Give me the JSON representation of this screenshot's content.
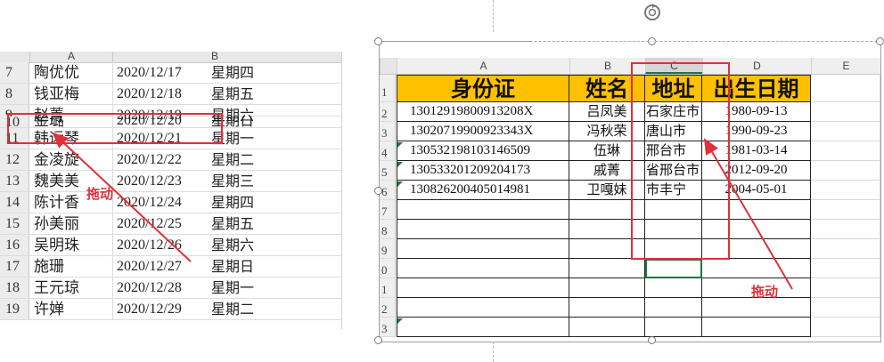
{
  "left_sheet": {
    "columns": [
      "A",
      "B"
    ],
    "rows": [
      {
        "num": "7",
        "name": "陶优优",
        "date": "2020/12/17",
        "week": "星期四"
      },
      {
        "num": "8",
        "name": "钱亚梅",
        "date": "2020/12/18",
        "week": "星期五"
      },
      {
        "num": "9",
        "name": "赵菁",
        "date": "2020/12/19",
        "week": "星期六"
      },
      {
        "num": "10",
        "name": "金璐",
        "date": "2020/12/20",
        "week": "星期日"
      },
      {
        "num": "11",
        "name": "韩远琴",
        "date": "2020/12/21",
        "week": "星期一"
      },
      {
        "num": "12",
        "name": "金凌旋",
        "date": "2020/12/22",
        "week": "星期二"
      },
      {
        "num": "13",
        "name": "魏美美",
        "date": "2020/12/23",
        "week": "星期三"
      },
      {
        "num": "14",
        "name": "陈计香",
        "date": "2020/12/24",
        "week": "星期四"
      },
      {
        "num": "15",
        "name": "孙美丽",
        "date": "2020/12/25",
        "week": "星期五"
      },
      {
        "num": "16",
        "name": "吴明珠",
        "date": "2020/12/26",
        "week": "星期六"
      },
      {
        "num": "17",
        "name": "施珊",
        "date": "2020/12/27",
        "week": "星期日"
      },
      {
        "num": "18",
        "name": "王元琼",
        "date": "2020/12/28",
        "week": "星期一"
      },
      {
        "num": "19",
        "name": "许婵",
        "date": "2020/12/29",
        "week": "星期二"
      }
    ],
    "annotation": "拖动"
  },
  "right_sheet": {
    "columns": [
      "A",
      "B",
      "C",
      "D",
      "E"
    ],
    "selected_column": "C",
    "header_row": {
      "num": "1",
      "cells": [
        "身份证",
        "姓名",
        "地址",
        "出生日期"
      ]
    },
    "data_rows": [
      {
        "num": "2",
        "id": "13012919800913208X",
        "name": "吕凤美",
        "addr": "石家庄市",
        "birth": "1980-09-13",
        "flag": false
      },
      {
        "num": "3",
        "id": "13020719900923343X",
        "name": "冯秋荣",
        "addr": "唐山市",
        "birth": "1990-09-23",
        "flag": false
      },
      {
        "num": "4",
        "id": "130532198103146509",
        "name": "伍琳",
        "addr": "邢台市",
        "birth": "1981-03-14",
        "flag": true
      },
      {
        "num": "5",
        "id": "130533201209204173",
        "name": "戚菁",
        "addr": "省邢台市",
        "birth": "2012-09-20",
        "flag": true
      },
      {
        "num": "6",
        "id": "130826200405014981",
        "name": "卫嘎妹",
        "addr": "市丰宁",
        "birth": "2004-05-01",
        "flag": true
      }
    ],
    "empty_rows": [
      "7",
      "8",
      "9",
      "0",
      "1",
      "2",
      "3"
    ],
    "annotation": "拖动"
  },
  "colors": {
    "header_fill": "#ffc000",
    "annotation": "#e0303a",
    "selection": "#217346"
  }
}
